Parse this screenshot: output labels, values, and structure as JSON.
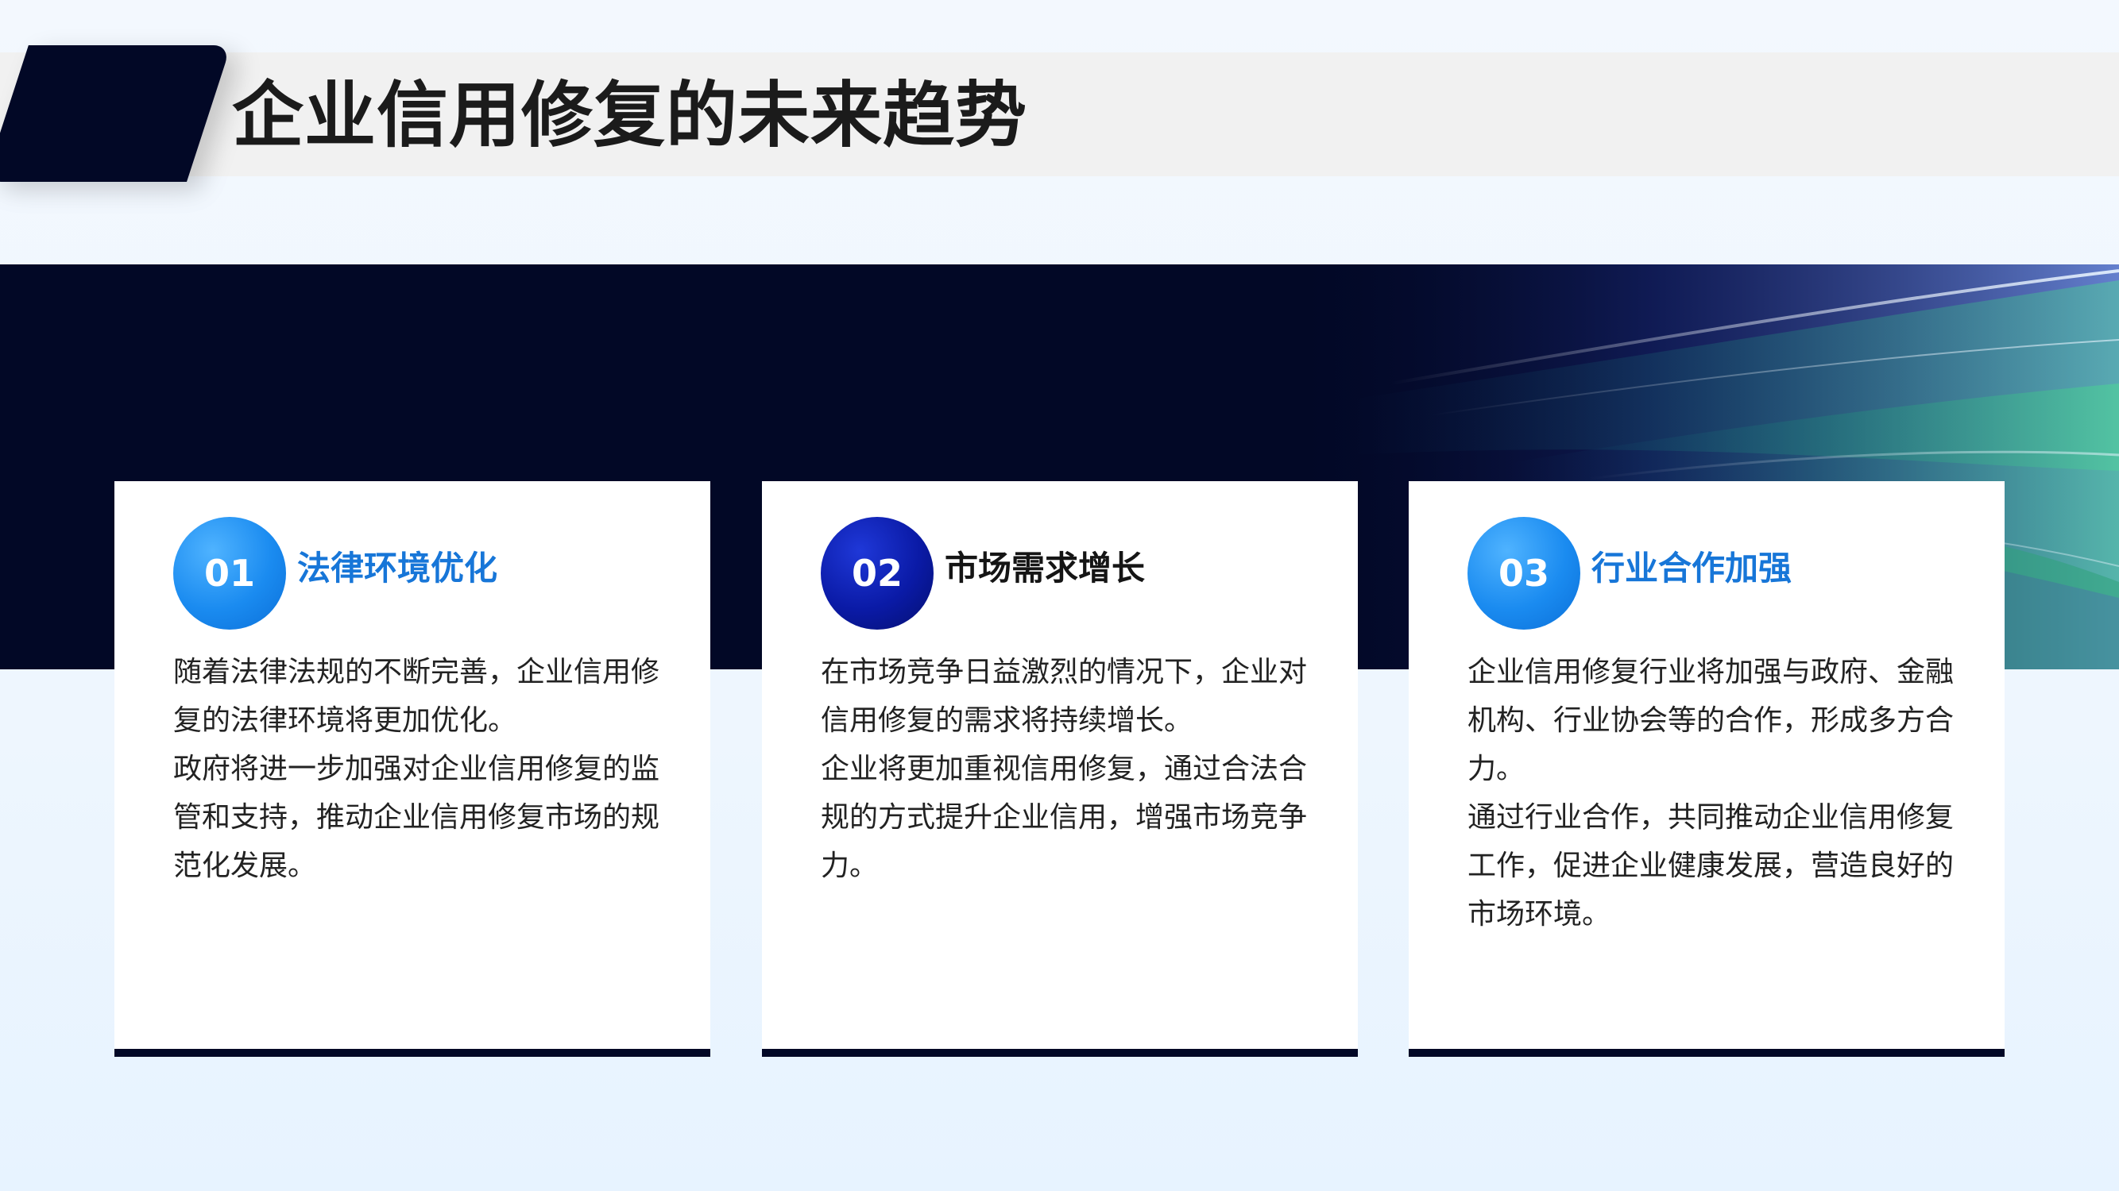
{
  "title": "企业信用修复的未来趋势",
  "cards": [
    {
      "number": "01",
      "heading": "法律环境优化",
      "paragraphs": [
        "随着法律法规的不断完善，企业信用修复的法律环境将更加优化。",
        "政府将进一步加强对企业信用修复的监管和支持，推动企业信用修复市场的规范化发展。"
      ]
    },
    {
      "number": "02",
      "heading": "市场需求增长",
      "paragraphs": [
        "在市场竞争日益激烈的情况下，企业对信用修复的需求将持续增长。",
        "企业将更加重视信用修复，通过合法合规的方式提升企业信用，增强市场竞争力。"
      ]
    },
    {
      "number": "03",
      "heading": "行业合作加强",
      "paragraphs": [
        "企业信用修复行业将加强与政府、金融机构、行业协会等的合作，形成多方合力。",
        "通过行业合作，共同推动企业信用修复工作，促进企业健康发展，营造良好的市场环境。"
      ]
    }
  ],
  "colors": {
    "dark_navy": "#020826",
    "accent_blue": "#1776d8",
    "accent_navy": "#0a1aa6",
    "title_strip": "#f1f1f1"
  }
}
